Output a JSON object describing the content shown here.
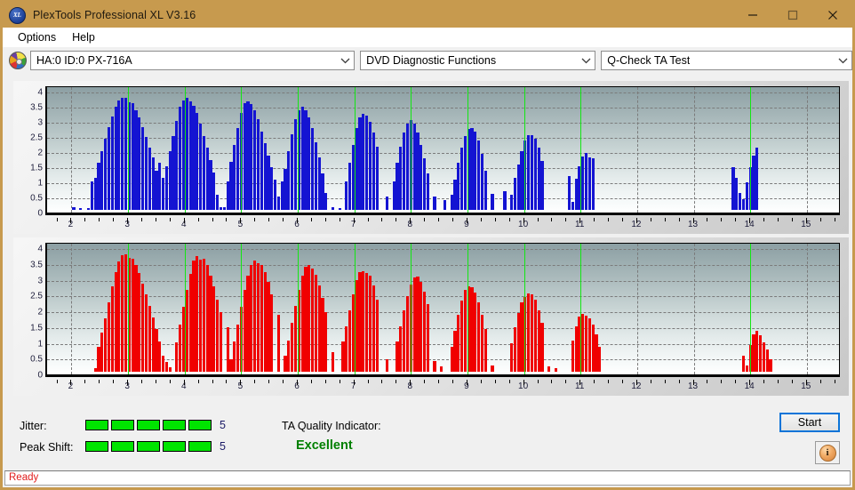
{
  "window": {
    "title": "PlexTools Professional XL V3.16",
    "app_icon": "xl-logo-icon",
    "minimize_label": "Minimize",
    "maximize_label": "Maximize",
    "close_label": "Close",
    "titlebar_color": "#c79a4e"
  },
  "menu": {
    "items": [
      {
        "label": "Options"
      },
      {
        "label": "Help"
      }
    ]
  },
  "toolbar": {
    "drive_icon": "disc-icon",
    "drive": {
      "value": "HA:0 ID:0  PX-716A"
    },
    "function": {
      "value": "DVD Diagnostic Functions"
    },
    "test": {
      "value": "Q-Check TA Test"
    }
  },
  "charts": [
    {
      "name": "jitter-chart",
      "color": "#1414d2",
      "bar_color": "#1414d2",
      "marker_color": "#13e613"
    },
    {
      "name": "peak-shift-chart",
      "color": "#f00000",
      "bar_color": "#f00000",
      "marker_color": "#13e613"
    }
  ],
  "chart_data": [
    {
      "type": "bar",
      "name": "jitter-chart",
      "title": "",
      "xlabel": "",
      "ylabel": "",
      "xlim": [
        1.6,
        15.6
      ],
      "ylim": [
        0,
        4.15
      ],
      "yticks": [
        0,
        0.5,
        1,
        1.5,
        2,
        2.5,
        3,
        3.5,
        4
      ],
      "ytick_labels": [
        "0",
        "0.5",
        "1",
        "1.5",
        "2",
        "2.5",
        "3",
        "3.5",
        "4"
      ],
      "xticks": [
        2,
        3,
        4,
        5,
        6,
        7,
        8,
        9,
        10,
        11,
        12,
        13,
        14,
        15
      ],
      "xtick_labels": [
        "2",
        "3",
        "4",
        "5",
        "6",
        "7",
        "8",
        "9",
        "10",
        "11",
        "12",
        "13",
        "14",
        "15"
      ],
      "grid": true,
      "markers": [
        3,
        4,
        5,
        6,
        7,
        8,
        9,
        10,
        11,
        14
      ],
      "bar_color": "#1414d2",
      "x": [
        2.04,
        2.16,
        2.3,
        2.36,
        2.42,
        2.48,
        2.54,
        2.6,
        2.66,
        2.72,
        2.78,
        2.84,
        2.9,
        2.96,
        3.02,
        3.08,
        3.14,
        3.2,
        3.26,
        3.32,
        3.38,
        3.44,
        3.5,
        3.56,
        3.62,
        3.68,
        3.74,
        3.8,
        3.86,
        3.92,
        3.98,
        4.04,
        4.1,
        4.16,
        4.22,
        4.28,
        4.34,
        4.4,
        4.46,
        4.52,
        4.58,
        4.64,
        4.7,
        4.76,
        4.82,
        4.88,
        4.94,
        5.0,
        5.06,
        5.12,
        5.18,
        5.24,
        5.3,
        5.36,
        5.42,
        5.48,
        5.54,
        5.6,
        5.66,
        5.72,
        5.78,
        5.84,
        5.9,
        5.96,
        6.02,
        6.08,
        6.14,
        6.2,
        6.26,
        6.32,
        6.38,
        6.44,
        6.5,
        6.62,
        6.74,
        6.86,
        6.92,
        6.98,
        7.04,
        7.1,
        7.16,
        7.22,
        7.28,
        7.34,
        7.4,
        7.58,
        7.7,
        7.76,
        7.82,
        7.88,
        7.94,
        8.0,
        8.06,
        8.12,
        8.18,
        8.24,
        8.3,
        8.42,
        8.6,
        8.72,
        8.78,
        8.84,
        8.9,
        8.96,
        9.02,
        9.08,
        9.14,
        9.2,
        9.26,
        9.32,
        9.44,
        9.66,
        9.78,
        9.84,
        9.9,
        9.96,
        10.02,
        10.08,
        10.14,
        10.2,
        10.26,
        10.32,
        10.8,
        10.86,
        10.92,
        10.98,
        11.04,
        11.1,
        11.16,
        11.22,
        13.7,
        13.76,
        13.82,
        13.88,
        13.94,
        14.0,
        14.06,
        14.12
      ],
      "values": [
        0.08,
        0.07,
        0.06,
        0.95,
        1.05,
        1.55,
        1.95,
        2.35,
        2.75,
        3.1,
        3.4,
        3.62,
        3.72,
        3.7,
        3.55,
        3.52,
        3.3,
        3.05,
        2.75,
        2.4,
        2.05,
        1.75,
        1.3,
        1.55,
        1.05,
        1.45,
        1.95,
        2.45,
        2.95,
        3.4,
        3.62,
        3.7,
        3.58,
        3.45,
        3.2,
        2.85,
        2.45,
        2.05,
        1.65,
        1.25,
        0.5,
        0.1,
        0.08,
        0.95,
        1.6,
        2.15,
        2.7,
        3.2,
        3.52,
        3.58,
        3.5,
        3.3,
        3.0,
        2.6,
        2.2,
        1.8,
        1.4,
        1.0,
        0.45,
        0.95,
        1.35,
        1.95,
        2.5,
        3.0,
        3.3,
        3.42,
        3.3,
        3.05,
        2.7,
        2.25,
        1.75,
        1.2,
        0.55,
        0.1,
        0.06,
        0.95,
        1.55,
        2.15,
        2.7,
        3.05,
        3.18,
        3.12,
        2.9,
        2.55,
        2.1,
        0.45,
        0.95,
        1.55,
        2.1,
        2.55,
        2.85,
        2.98,
        2.85,
        2.55,
        2.15,
        1.7,
        1.2,
        0.45,
        0.32,
        0.5,
        1.0,
        1.55,
        2.05,
        2.45,
        2.68,
        2.7,
        2.6,
        2.3,
        1.85,
        1.3,
        0.52,
        0.62,
        0.5,
        1.05,
        1.5,
        1.95,
        2.3,
        2.47,
        2.48,
        2.35,
        2.05,
        1.62,
        1.12,
        0.28,
        1.02,
        1.45,
        1.78,
        1.88,
        1.74,
        1.72,
        1.4,
        1.05,
        0.55,
        0.35,
        0.92,
        1.42,
        1.8,
        2.05,
        2.18,
        2.12,
        1.85,
        1.2,
        0.5
      ]
    },
    {
      "type": "bar",
      "name": "peak-shift-chart",
      "title": "",
      "xlabel": "",
      "ylabel": "",
      "xlim": [
        1.6,
        15.6
      ],
      "ylim": [
        0,
        4.15
      ],
      "yticks": [
        0,
        0.5,
        1,
        1.5,
        2,
        2.5,
        3,
        3.5,
        4
      ],
      "ytick_labels": [
        "0",
        "0.5",
        "1",
        "1.5",
        "2",
        "2.5",
        "3",
        "3.5",
        "4"
      ],
      "xticks": [
        2,
        3,
        4,
        5,
        6,
        7,
        8,
        9,
        10,
        11,
        12,
        13,
        14,
        15
      ],
      "xtick_labels": [
        "2",
        "3",
        "4",
        "5",
        "6",
        "7",
        "8",
        "9",
        "10",
        "11",
        "12",
        "13",
        "14",
        "15"
      ],
      "grid": true,
      "markers": [
        3,
        4,
        5,
        6,
        7,
        8,
        9,
        10,
        11,
        14
      ],
      "bar_color": "#f00000",
      "x": [
        2.42,
        2.48,
        2.54,
        2.6,
        2.66,
        2.72,
        2.78,
        2.84,
        2.9,
        2.96,
        3.02,
        3.08,
        3.14,
        3.2,
        3.26,
        3.32,
        3.38,
        3.44,
        3.5,
        3.56,
        3.62,
        3.68,
        3.74,
        3.86,
        3.92,
        3.98,
        4.04,
        4.1,
        4.16,
        4.22,
        4.28,
        4.34,
        4.4,
        4.46,
        4.52,
        4.58,
        4.64,
        4.76,
        4.82,
        4.88,
        4.94,
        5.0,
        5.06,
        5.12,
        5.18,
        5.24,
        5.3,
        5.36,
        5.42,
        5.48,
        5.54,
        5.66,
        5.78,
        5.84,
        5.9,
        5.96,
        6.02,
        6.08,
        6.14,
        6.2,
        6.26,
        6.32,
        6.38,
        6.44,
        6.5,
        6.62,
        6.8,
        6.86,
        6.92,
        6.98,
        7.04,
        7.1,
        7.16,
        7.22,
        7.28,
        7.34,
        7.4,
        7.58,
        7.76,
        7.82,
        7.88,
        7.94,
        8.0,
        8.06,
        8.12,
        8.18,
        8.24,
        8.3,
        8.42,
        8.54,
        8.72,
        8.78,
        8.84,
        8.9,
        8.96,
        9.02,
        9.08,
        9.14,
        9.2,
        9.26,
        9.32,
        9.44,
        9.78,
        9.84,
        9.9,
        9.96,
        10.02,
        10.08,
        10.14,
        10.2,
        10.26,
        10.32,
        10.44,
        10.56,
        10.86,
        10.92,
        10.98,
        11.04,
        11.1,
        11.16,
        11.22,
        11.28,
        11.34,
        13.88,
        13.94,
        14.0,
        14.06,
        14.12,
        14.18,
        14.24,
        14.3,
        14.36
      ],
      "values": [
        0.1,
        0.8,
        1.25,
        1.7,
        2.2,
        2.7,
        3.15,
        3.5,
        3.7,
        3.72,
        3.6,
        3.58,
        3.4,
        3.12,
        2.8,
        2.45,
        2.1,
        1.72,
        1.35,
        0.95,
        0.5,
        0.3,
        0.15,
        0.92,
        1.5,
        2.05,
        2.6,
        3.1,
        3.52,
        3.66,
        3.55,
        3.58,
        3.38,
        3.05,
        2.7,
        2.3,
        1.9,
        1.4,
        0.4,
        0.95,
        1.5,
        2.05,
        2.6,
        3.05,
        3.4,
        3.52,
        3.45,
        3.4,
        3.15,
        2.85,
        2.45,
        1.8,
        0.5,
        1.0,
        1.55,
        2.1,
        2.6,
        3.05,
        3.32,
        3.38,
        3.28,
        3.08,
        2.75,
        2.35,
        1.9,
        0.62,
        0.95,
        1.45,
        1.95,
        2.45,
        2.9,
        3.15,
        3.2,
        3.12,
        3.05,
        2.75,
        2.3,
        0.4,
        0.95,
        1.45,
        1.95,
        2.4,
        2.78,
        3.0,
        3.02,
        2.85,
        2.55,
        2.15,
        0.35,
        0.18,
        0.8,
        1.3,
        1.8,
        2.25,
        2.6,
        2.7,
        2.68,
        2.5,
        2.2,
        1.8,
        1.35,
        0.2,
        0.9,
        1.4,
        1.85,
        2.2,
        2.38,
        2.48,
        2.45,
        2.3,
        1.95,
        1.55,
        0.18,
        0.1,
        1.0,
        1.45,
        1.75,
        1.84,
        1.78,
        1.7,
        1.5,
        1.18,
        0.8,
        0.5,
        0.2,
        0.85,
        1.18,
        1.3,
        1.15,
        0.92,
        0.7,
        0.4,
        0.38
      ]
    }
  ],
  "bottom": {
    "jitter_label": "Jitter:",
    "jitter_value": "5",
    "jitter_segments": 5,
    "jitter_segments_total": 5,
    "peak_shift_label": "Peak Shift:",
    "peak_shift_value": "5",
    "peak_shift_segments": 5,
    "peak_shift_segments_total": 5,
    "ta_quality_label": "TA Quality Indicator:",
    "ta_quality_value": "Excellent",
    "ta_quality_color": "#008000",
    "start_label": "Start",
    "info_icon": "info-icon",
    "info_glyph": "i"
  },
  "status": {
    "text": "Ready",
    "color": "#e01b1b"
  }
}
